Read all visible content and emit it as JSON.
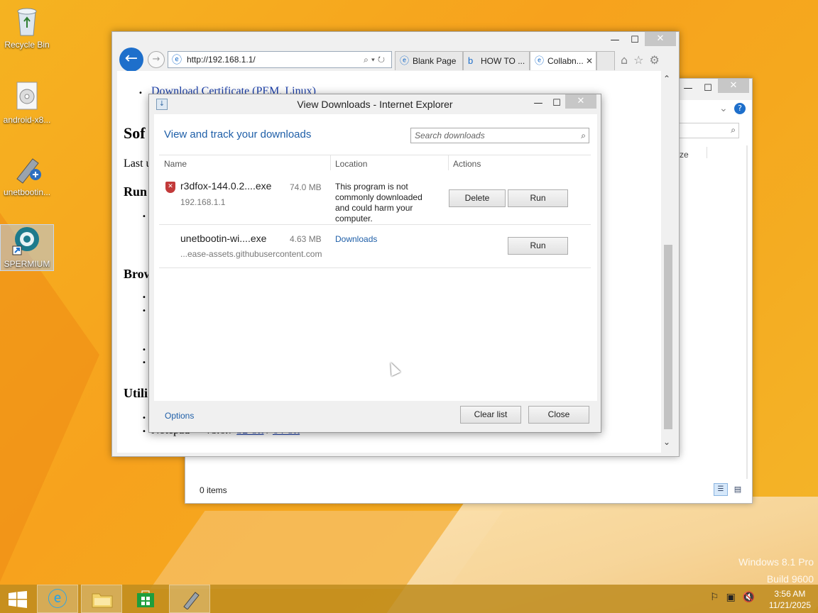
{
  "desktop": {
    "icons": [
      {
        "label": "Recycle Bin",
        "icon": "recycle-bin-icon"
      },
      {
        "label": "android-x8...",
        "icon": "disc-image-icon"
      },
      {
        "label": "unetbootin...",
        "icon": "unetbootin-icon"
      },
      {
        "label": "SPERMIUM",
        "icon": "browser-shortcut-icon"
      }
    ],
    "watermark": {
      "line1": "Windows 8.1 Pro",
      "line2": "Build 9600"
    }
  },
  "explorer": {
    "status": "0 items",
    "partial_column": "ze"
  },
  "ie": {
    "address": "http://192.168.1.1/",
    "tabs": [
      {
        "label": "Blank Page",
        "icon": "ie-icon"
      },
      {
        "label": "HOW TO ...",
        "icon": "bing-icon"
      },
      {
        "label": "Collabn...",
        "icon": "ie-icon",
        "active": true
      }
    ],
    "page": {
      "link_top": "Download Certificate (PEM, Linux)",
      "h_sof": "Sof",
      "t_last": "Last u",
      "h_run": "Run",
      "h_brow": "Brow",
      "h_util": "Utili",
      "notepad_text": "Notepad++ v8.6.7",
      "notepad_link1": "32-bit",
      "notepad_sep": " / ",
      "notepad_link2": "64-bit"
    }
  },
  "downloads": {
    "title": "View Downloads - Internet Explorer",
    "heading": "View and track your downloads",
    "search_placeholder": "Search downloads",
    "columns": {
      "name": "Name",
      "location": "Location",
      "actions": "Actions"
    },
    "items": [
      {
        "name": "r3dfox-144.0.2....exe",
        "size": "74.0 MB",
        "source": "192.168.1.1",
        "location": "This program is not commonly downloaded and could harm your computer.",
        "buttons": [
          "Delete",
          "Run"
        ]
      },
      {
        "name": "unetbootin-wi....exe",
        "size": "4.63 MB",
        "source": "...ease-assets.githubusercontent.com",
        "location": "Downloads",
        "buttons": [
          "Run"
        ]
      }
    ],
    "options_label": "Options",
    "clear_label": "Clear list",
    "close_label": "Close"
  },
  "taskbar": {
    "time": "3:56 AM",
    "date": "11/21/2025"
  }
}
